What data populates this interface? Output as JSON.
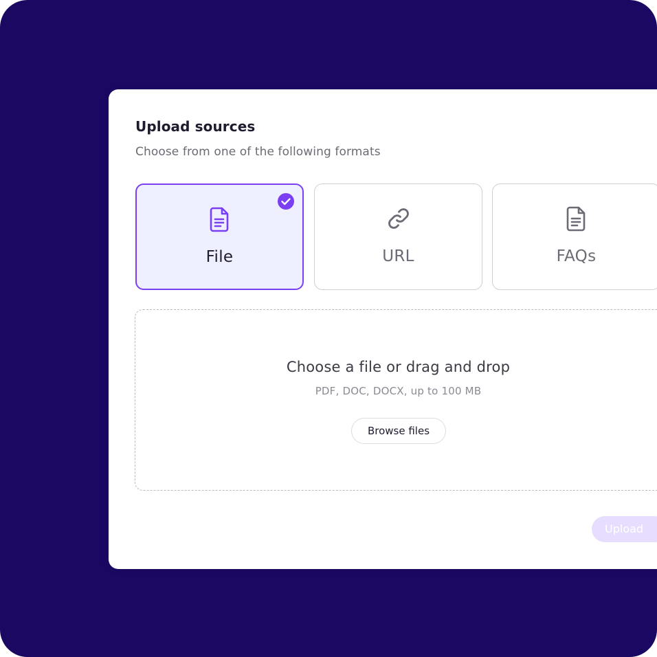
{
  "header": {
    "title": "Upload sources",
    "subtitle": "Choose from one of the following formats"
  },
  "options": [
    {
      "label": "File",
      "icon": "file-document-icon",
      "selected": true
    },
    {
      "label": "URL",
      "icon": "link-icon",
      "selected": false
    },
    {
      "label": "FAQs",
      "icon": "faq-document-icon",
      "selected": false
    }
  ],
  "dropzone": {
    "title": "Choose a file or drag and drop",
    "hint": "PDF, DOC, DOCX, up to 100 MB",
    "browse_label": "Browse files"
  },
  "footer": {
    "upload_label": "Upload"
  },
  "colors": {
    "background": "#1b0863",
    "accent": "#7a3ff2",
    "selected_fill": "#eef0ff",
    "upload_disabled": "#e7ddff"
  }
}
